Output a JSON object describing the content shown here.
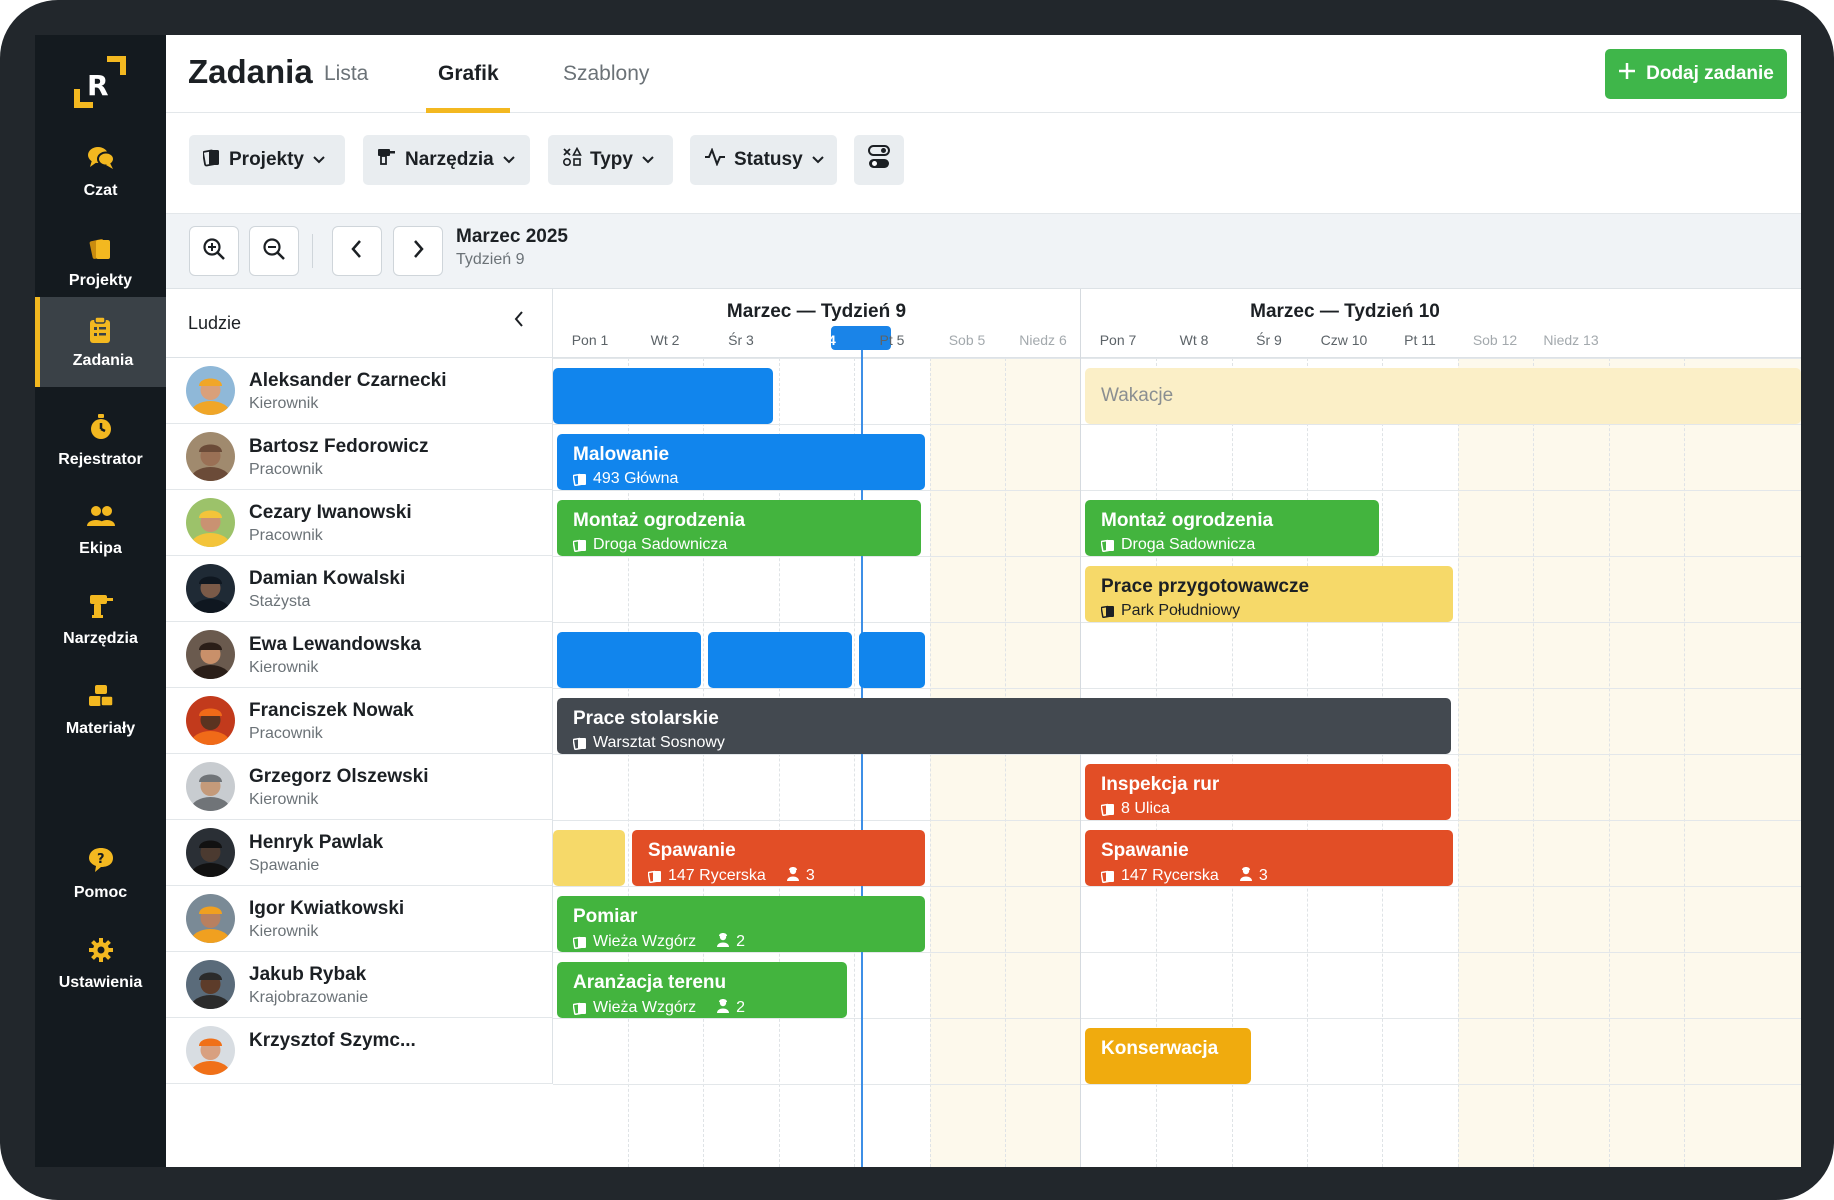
{
  "app": {
    "title": "Zadania"
  },
  "sidebar": {
    "items": [
      {
        "label": "Czat",
        "icon": "chat-icon"
      },
      {
        "label": "Projekty",
        "icon": "projects-icon"
      },
      {
        "label": "Zadania",
        "icon": "clipboard-icon",
        "active": true
      },
      {
        "label": "Rejestrator",
        "icon": "stopwatch-icon"
      },
      {
        "label": "Ekipa",
        "icon": "team-icon"
      },
      {
        "label": "Narzędzia",
        "icon": "drill-icon"
      },
      {
        "label": "Materiały",
        "icon": "materials-icon"
      },
      {
        "label": "Pomoc",
        "icon": "help-icon"
      },
      {
        "label": "Ustawienia",
        "icon": "gear-icon"
      }
    ]
  },
  "header": {
    "tabs": [
      {
        "label": "Lista"
      },
      {
        "label": "Grafik",
        "active": true
      },
      {
        "label": "Szablony"
      }
    ],
    "add_button": "Dodaj zadanie"
  },
  "filters": {
    "projects": "Projekty",
    "tools": "Narzędzia",
    "types": "Typy",
    "statuses": "Statusy"
  },
  "toolbar": {
    "month": "Marzec 2025",
    "week": "Tydzień 9"
  },
  "people_header": "Ludzie",
  "weeks": [
    {
      "title": "Marzec — Tydzień 9",
      "days": [
        "Pon 1",
        "Wt 2",
        "Śr 3",
        "Czw 4",
        "Pt 5",
        "Sob 5",
        "Niedz 6"
      ]
    },
    {
      "title": "Marzec — Tydzień 10",
      "days": [
        "Pon 7",
        "Wt 8",
        "Śr 9",
        "Czw 10",
        "Pt 11",
        "Sob 12",
        "Niedz 13"
      ]
    }
  ],
  "today": "Czw 4",
  "people": [
    {
      "name": "Aleksander Czarnecki",
      "role": "Kierownik"
    },
    {
      "name": "Bartosz Fedorowicz",
      "role": "Pracownik"
    },
    {
      "name": "Cezary Iwanowski",
      "role": "Pracownik"
    },
    {
      "name": "Damian Kowalski",
      "role": "Stażysta"
    },
    {
      "name": "Ewa Lewandowska",
      "role": "Kierownik"
    },
    {
      "name": "Franciszek Nowak",
      "role": "Pracownik"
    },
    {
      "name": "Grzegorz Olszewski",
      "role": "Kierownik"
    },
    {
      "name": "Henryk Pawlak",
      "role": "Spawanie"
    },
    {
      "name": "Igor Kwiatkowski",
      "role": "Kierownik"
    },
    {
      "name": "Jakub Rybak",
      "role": "Krajobrazowanie"
    },
    {
      "name": "Krzysztof Szymc...",
      "role": ""
    }
  ],
  "tasks": {
    "r0_vac": "Wakacje",
    "r1_a": {
      "title": "Malowanie",
      "place": "493 Główna"
    },
    "r2_a": {
      "title": "Montaż ogrodzenia",
      "place": "Droga Sadownicza"
    },
    "r2_b": {
      "title": "Montaż ogrodzenia",
      "place": "Droga Sadownicza"
    },
    "r3_b": {
      "title": "Prace przygotowawcze",
      "place": "Park Południowy"
    },
    "r5_a": {
      "title": "Prace stolarskie",
      "place": "Warsztat Sosnowy"
    },
    "r6_b": {
      "title": "Inspekcja rur",
      "place": "8 Ulica"
    },
    "r7_a": {
      "title": "Spawanie",
      "place": "147 Rycerska",
      "count": "3"
    },
    "r7_b": {
      "title": "Spawanie",
      "place": "147 Rycerska",
      "count": "3"
    },
    "r8_a": {
      "title": "Pomiar",
      "place": "Wieża Wzgórz",
      "count": "2"
    },
    "r9_a": {
      "title": "Aranżacja terenu",
      "place": "Wieża Wzgórz",
      "count": "2"
    },
    "r10_b": {
      "title": "Konserwacja"
    }
  },
  "colors": {
    "accent": "#f3b820",
    "blue": "#1185ed",
    "green": "#43b43e",
    "orange": "#e24e26",
    "dark": "#434950",
    "yellow": "#f6d969",
    "amber": "#f0ab0e",
    "add_button": "#3fb64a"
  }
}
